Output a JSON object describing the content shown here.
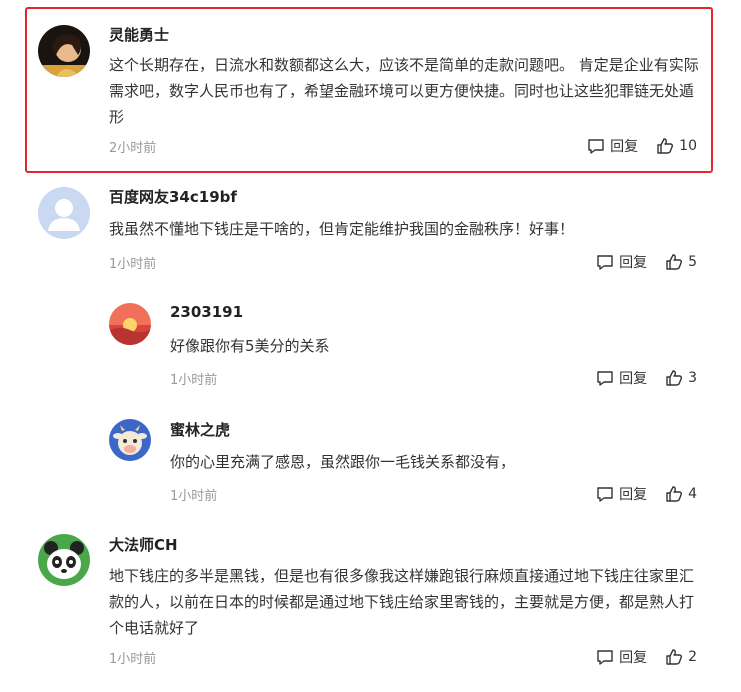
{
  "reply_label": "回复",
  "comments": [
    {
      "user": "灵能勇士",
      "text": "这个长期存在，日流水和数额都这么大，应该不是简单的走款问题吧。 肯定是企业有实际需求吧，数字人民币也有了，希望金融环境可以更方便快捷。同时也让这些犯罪链无处遁形",
      "time": "2小时前",
      "likes": "10",
      "avatar": "photo-avatar"
    },
    {
      "user": "百度网友34c19bf",
      "text": "我虽然不懂地下钱庄是干啥的，但肯定能维护我国的金融秩序！好事！",
      "time": "1小时前",
      "likes": "5",
      "avatar": "default-user-avatar"
    },
    {
      "user": "2303191",
      "text": "好像跟你有5美分的关系",
      "time": "1小时前",
      "likes": "3",
      "avatar": "sunset-avatar"
    },
    {
      "user": "蜜林之虎",
      "text": "你的心里充满了感恩，虽然跟你一毛钱关系都没有，",
      "time": "1小时前",
      "likes": "4",
      "avatar": "cow-cartoon-avatar"
    },
    {
      "user": "大法师CH",
      "text": "地下钱庄的多半是黑钱，但是也有很多像我这样嫌跑银行麻烦直接通过地下钱庄往家里汇款的人，以前在日本的时候都是通过地下钱庄给家里寄钱的，主要就是方便，都是熟人打个电话就好了",
      "time": "1小时前",
      "likes": "2",
      "avatar": "panda-avatar"
    }
  ],
  "colors": {
    "highlight_border": "#e0282e",
    "time_text": "#999999",
    "username_text": "#222222"
  }
}
